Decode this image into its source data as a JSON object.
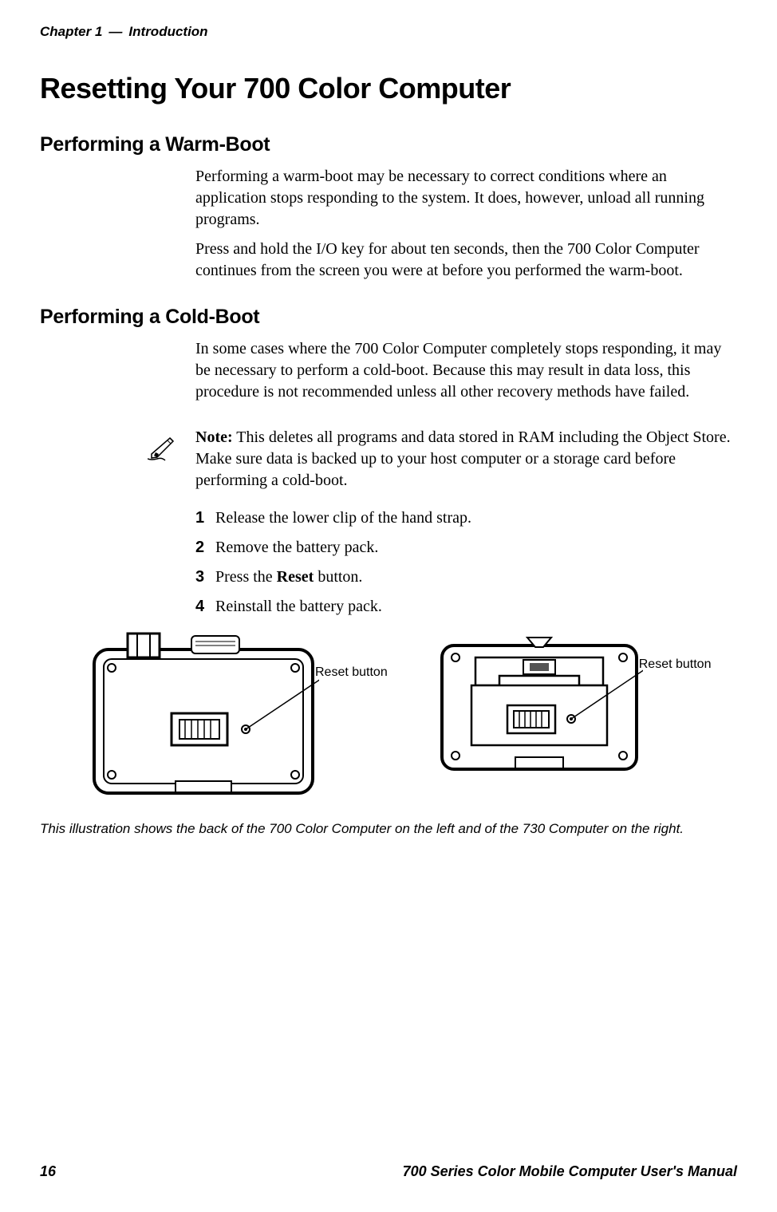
{
  "header": {
    "chapter": "Chapter 1",
    "separator": "—",
    "title": "Introduction"
  },
  "h1": "Resetting Your 700 Color Computer",
  "sections": {
    "warm": {
      "title": "Performing a Warm-Boot",
      "p1": "Performing a warm-boot may be necessary to correct conditions where an application stops responding to the system. It does, however, unload all running programs.",
      "p2": "Press and hold the I/O key for about ten seconds, then the 700 Color Computer continues from the screen you were at before you performed the warm-boot."
    },
    "cold": {
      "title": "Performing a Cold-Boot",
      "p1": "In some cases where the 700 Color Computer completely stops responding, it may be necessary to perform a cold-boot. Because this may result in data loss, this procedure is not recommended unless all other recovery methods have failed.",
      "note_label": "Note:",
      "note_text": " This deletes all programs and data stored in RAM including the Object Store. Make sure data is backed up to your host computer or a storage card before performing a cold-boot.",
      "steps": [
        {
          "n": "1",
          "text": "Release the lower clip of the hand strap."
        },
        {
          "n": "2",
          "text": "Remove the battery pack."
        },
        {
          "n": "3",
          "text_before": "Press the ",
          "bold": "Reset",
          "text_after": " button."
        },
        {
          "n": "4",
          "text": "Reinstall the battery pack."
        }
      ]
    }
  },
  "illustration": {
    "label1": "Reset button",
    "label2": "Reset button",
    "caption": "This illustration shows the back of the 700  Color Computer on the left and of the 730 Computer on the right."
  },
  "footer": {
    "page": "16",
    "title": "700 Series Color Mobile Computer User's Manual"
  }
}
